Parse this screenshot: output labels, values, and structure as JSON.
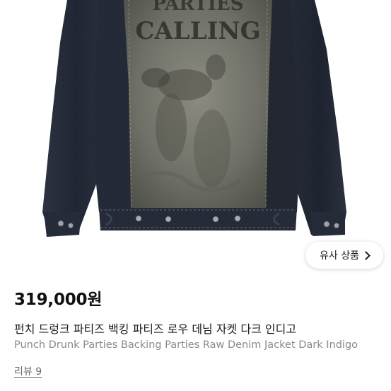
{
  "product": {
    "image_alt": "Denim jacket back with printed graphic panel",
    "graphic_text_line1": "PARTIES",
    "graphic_text_line2": "CALLING"
  },
  "similar_button": {
    "label": "유사 상품",
    "icon": "chevron-right-icon"
  },
  "price": "319,000원",
  "title_ko": "펀치 드렁크 파티즈 백킹 파티즈 로우 데님 자켓 다크 인디고",
  "title_en": "Punch Drunk Parties Backing Parties Raw Denim Jacket Dark Indigo",
  "review": {
    "label": "리뷰 9"
  }
}
